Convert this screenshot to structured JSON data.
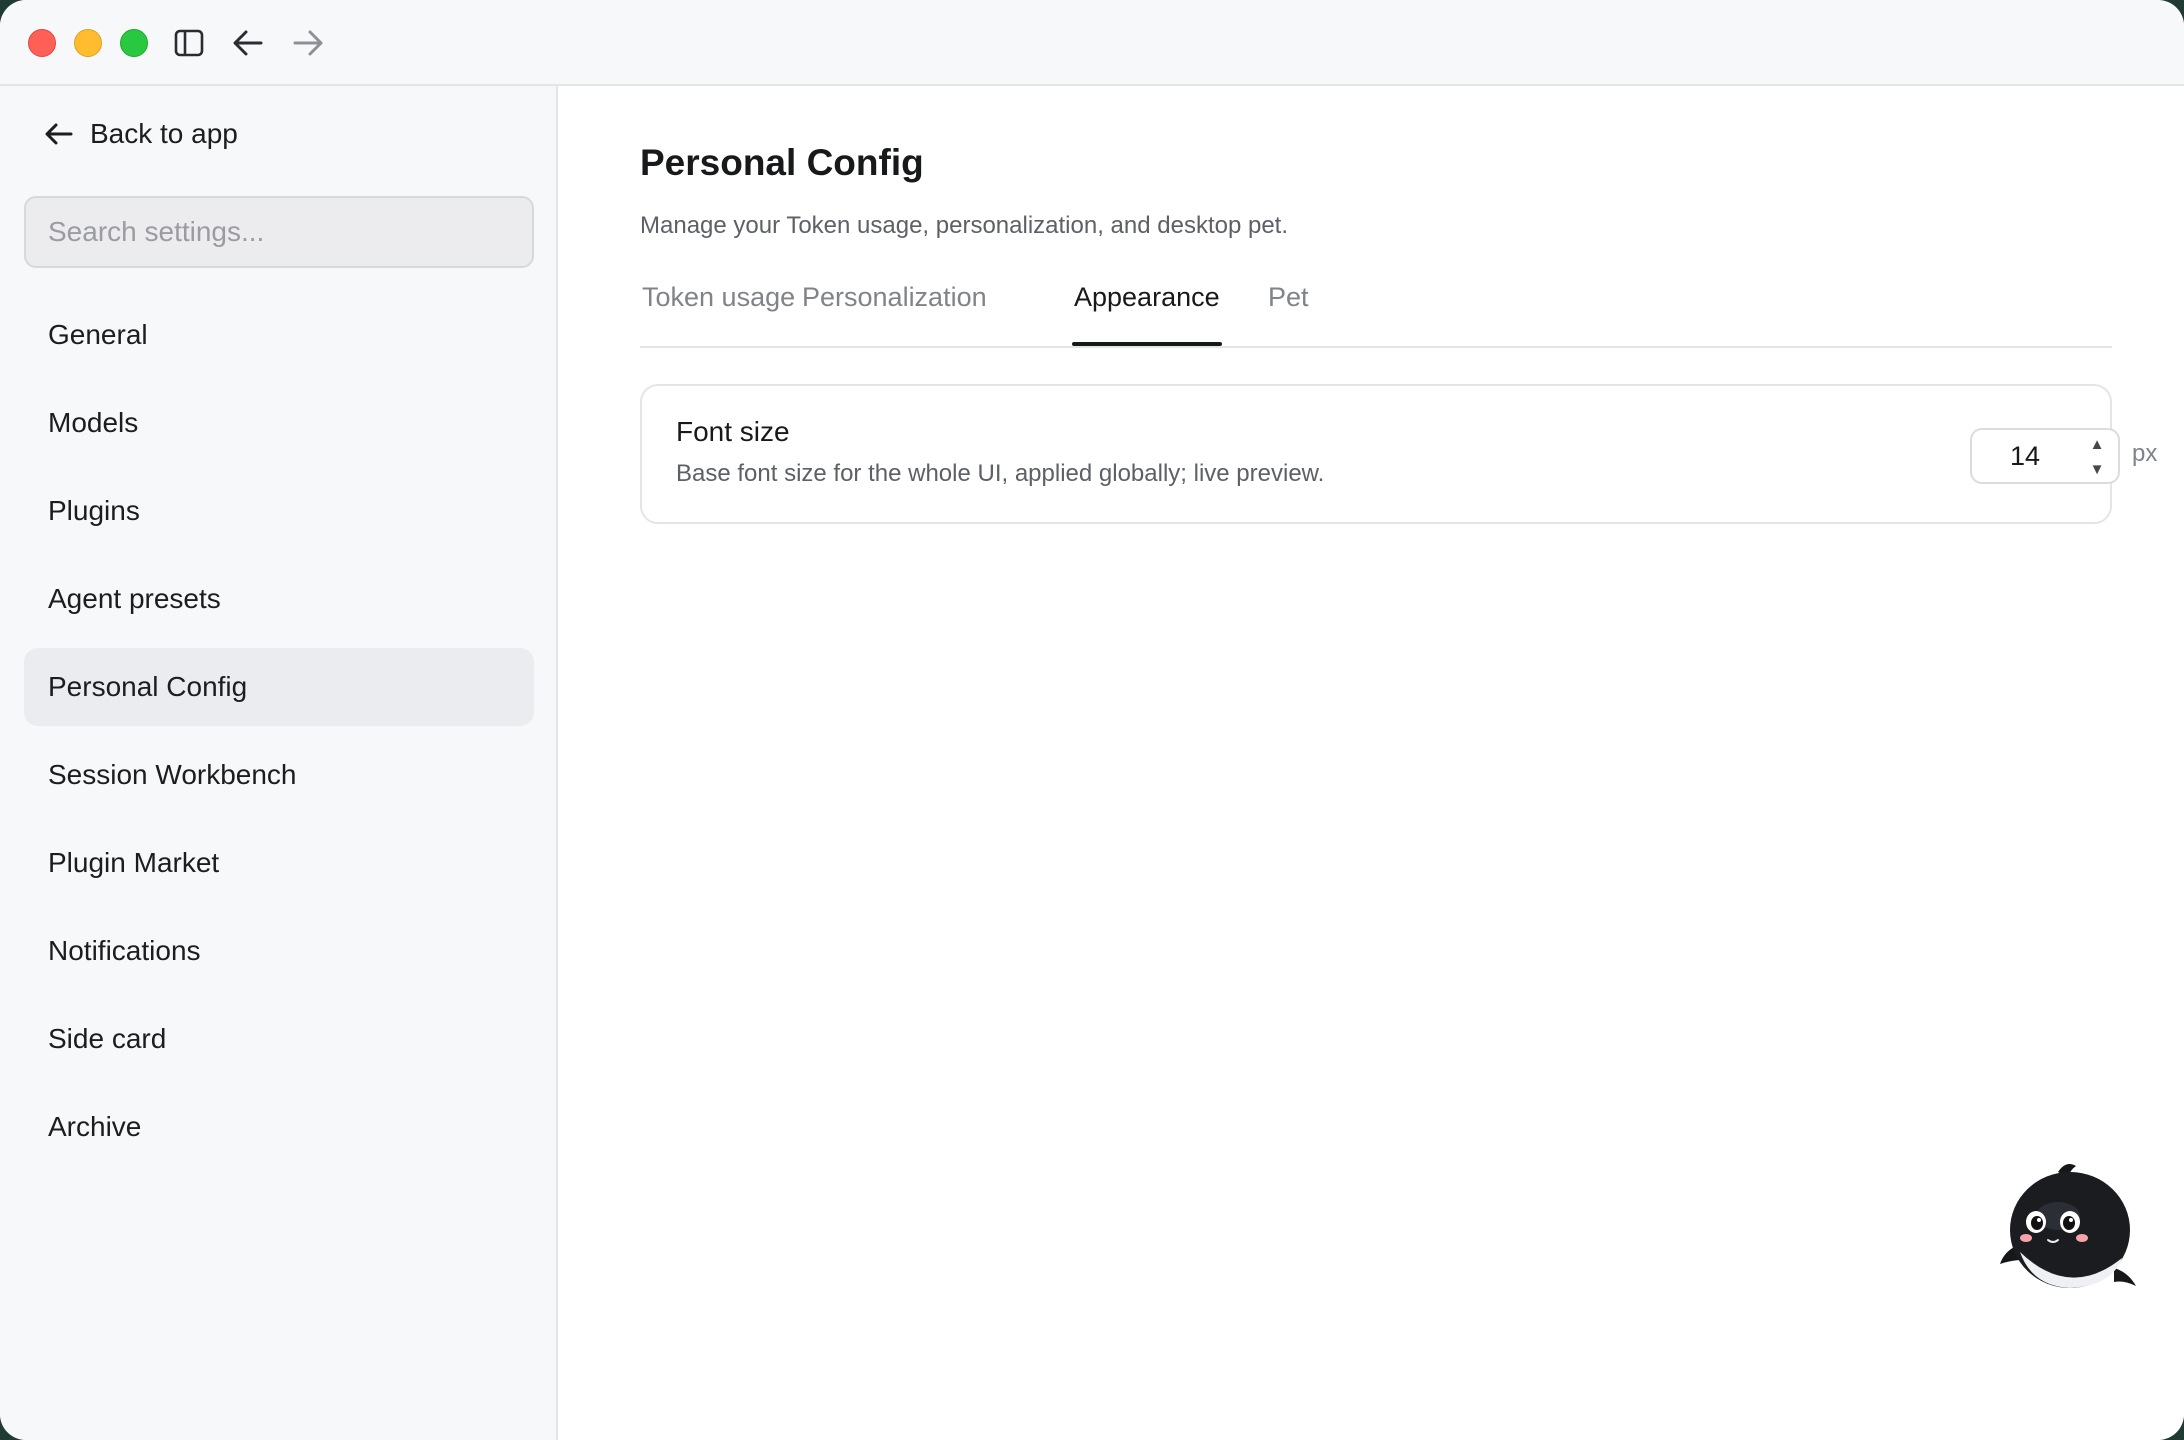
{
  "window": {
    "controls": [
      "close",
      "minimize",
      "maximize"
    ],
    "toolbar_icons": [
      "sidebar-toggle-icon",
      "back-arrow-icon",
      "forward-arrow-icon"
    ]
  },
  "sidebar": {
    "back_label": "Back to app",
    "search_placeholder": "Search settings...",
    "items": [
      {
        "label": "General",
        "active": false
      },
      {
        "label": "Models",
        "active": false
      },
      {
        "label": "Plugins",
        "active": false
      },
      {
        "label": "Agent presets",
        "active": false
      },
      {
        "label": "Personal Config",
        "active": true
      },
      {
        "label": "Session Workbench",
        "active": false
      },
      {
        "label": "Plugin Market",
        "active": false
      },
      {
        "label": "Notifications",
        "active": false
      },
      {
        "label": "Side card",
        "active": false
      },
      {
        "label": "Archive",
        "active": false
      }
    ]
  },
  "main": {
    "title": "Personal Config",
    "subtitle": "Manage your Token usage, personalization, and desktop pet.",
    "tabs": [
      {
        "label": "Token usage",
        "active": false
      },
      {
        "label": "Personalization",
        "active": false
      },
      {
        "label": "Appearance",
        "active": true
      },
      {
        "label": "Pet",
        "active": false
      }
    ],
    "font_size_setting": {
      "title": "Font size",
      "description": "Base font size for the whole UI, applied globally; live preview.",
      "value": "14",
      "unit": "px",
      "up_glyph": "▲",
      "down_glyph": "▼"
    }
  },
  "pet": {
    "icon": "orca-pet-icon"
  },
  "colors": {
    "accent": "#18191b",
    "sidebar_bg": "#f7f8fa",
    "active_item_bg": "#eaecef",
    "close": "#fe5f57",
    "minimize": "#febc2e",
    "maximize": "#28c840"
  }
}
